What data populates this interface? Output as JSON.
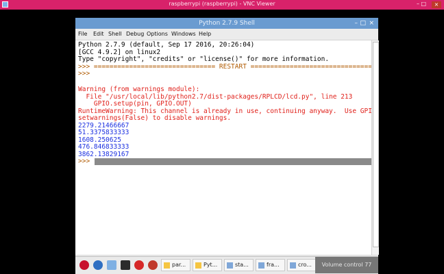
{
  "vnc": {
    "title": "raspberrypi (raspberrypi) - VNC Viewer",
    "minimize": "–",
    "maximize": "□",
    "close": "×"
  },
  "window": {
    "title": "Python 2.7.9 Shell",
    "minimize": "–",
    "maximize": "□",
    "close": "×"
  },
  "menu": {
    "file": "File",
    "edit": "Edit",
    "shell": "Shell",
    "debug": "Debug",
    "options": "Options",
    "windows": "Windows",
    "help": "Help"
  },
  "shell": {
    "lines": [
      "Python 2.7.9 (default, Sep 17 2016, 20:26:04)",
      "[GCC 4.9.2] on linux2",
      "Type \"copyright\", \"credits\" or \"license()\" for more information.",
      ">>> =============================== RESTART ===============================",
      ">>>",
      "",
      "Warning (from warnings module):",
      "  File \"/usr/local/lib/python2.7/dist-packages/RPLCD/lcd.py\", line 213",
      "    GPIO.setup(pin, GPIO.OUT)",
      "RuntimeWarning: This channel is already in use, continuing anyway.  Use GPIO.",
      "setwarnings(False) to disable warnings.",
      "2279.21466667",
      "51.3375833333",
      "1608.250625",
      "476.846833333",
      "3862.13829167",
      ">>>"
    ]
  },
  "taskbar": {
    "tasks": [
      "par...",
      "Pyt...",
      "sta...",
      "fra...",
      "cro..."
    ],
    "volume": "Volume control 77"
  },
  "colors": {
    "vnc_bar": "#d8226a",
    "titlebar": "#6a9bd0",
    "warning": "#e0201a",
    "output": "#1a2fe0"
  }
}
